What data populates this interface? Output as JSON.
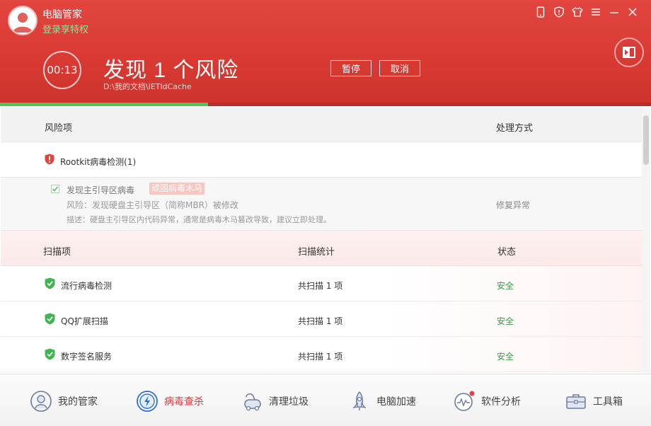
{
  "header": {
    "app_title": "电脑管家",
    "login_text": "登录享特权",
    "timer": "00:13",
    "headline": "发现 1 个风险",
    "scan_path": "D:\\我的文档\\IETldCache",
    "pause_label": "暂停",
    "cancel_label": "取消",
    "progress_percent": 32
  },
  "window_controls": [
    "phone-icon",
    "shield-icon",
    "shirt-icon",
    "menu-icon",
    "minimize-icon",
    "close-icon"
  ],
  "risk_table": {
    "col_item": "风险项",
    "col_action": "处理方式",
    "group_label": "Rootkit病毒检测(1)",
    "detail": {
      "checked": true,
      "name": "发现主引导区病毒",
      "tag": "顽固病毒木马",
      "risk": "风险：发现硬盘主引导区（简称MBR）被修改",
      "desc": "描述：硬盘主引导区内代码异常，通常是病毒木马篡改导致，建议立即处理。",
      "action": "修复异常"
    }
  },
  "scan_table": {
    "col_item": "扫描项",
    "col_stats": "扫描统计",
    "col_status": "状态",
    "rows": [
      {
        "name": "流行病毒检测",
        "stats": "共扫描 1 项",
        "status": "安全"
      },
      {
        "name": "QQ扩展扫描",
        "stats": "共扫描 1 项",
        "status": "安全"
      },
      {
        "name": "数字签名服务",
        "stats": "共扫描 1 项",
        "status": "安全"
      }
    ]
  },
  "bottom_nav": [
    {
      "label": "我的管家",
      "icon": "butler-icon"
    },
    {
      "label": "病毒查杀",
      "icon": "virus-scan-icon",
      "active": true
    },
    {
      "label": "清理垃圾",
      "icon": "vacuum-icon"
    },
    {
      "label": "电脑加速",
      "icon": "rocket-icon"
    },
    {
      "label": "软件分析",
      "icon": "software-analysis-icon"
    },
    {
      "label": "工具箱",
      "icon": "toolbox-icon"
    }
  ],
  "colors": {
    "header_red": "#d93a34",
    "safe_green": "#2e9e3f",
    "progress_green": "#4cc65a",
    "active_nav": "#d8393a"
  }
}
